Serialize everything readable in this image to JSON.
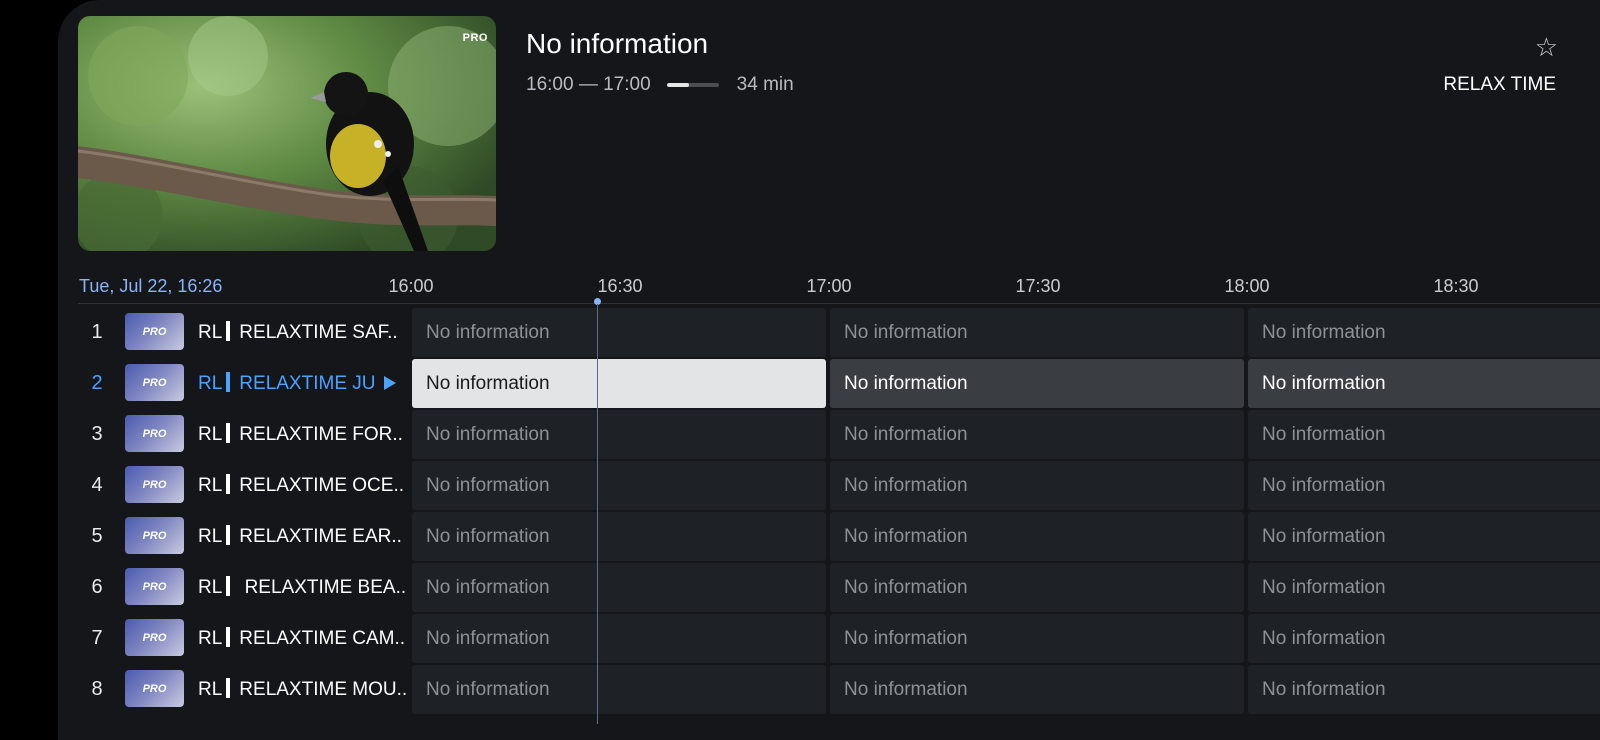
{
  "preview": {
    "badge": "PRO"
  },
  "program": {
    "title": "No information",
    "time_range": "16:00 — 17:00",
    "progress": 0.43,
    "duration": "34 min",
    "channel": "RELAX TIME",
    "icons": {
      "favorite": "star-outline-icon"
    }
  },
  "guide": {
    "date_label": "Tue, Jul 22, 16:26",
    "times": [
      "16:00",
      "16:30",
      "17:00",
      "17:30",
      "18:00",
      "18:30"
    ],
    "channels": [
      {
        "num": "1",
        "logo": "PRO",
        "prefix": "RL",
        "name": "RELAXTIME SAF..",
        "programs": [
          "No information",
          "No information",
          "No information"
        ]
      },
      {
        "num": "2",
        "logo": "PRO",
        "prefix": "RL",
        "name": "RELAXTIME JU",
        "programs": [
          "No information",
          "No information",
          "No information"
        ]
      },
      {
        "num": "3",
        "logo": "PRO",
        "prefix": "RL",
        "name": "RELAXTIME FOR..",
        "programs": [
          "No information",
          "No information",
          "No information"
        ]
      },
      {
        "num": "4",
        "logo": "PRO",
        "prefix": "RL",
        "name": "RELAXTIME OCE..",
        "programs": [
          "No information",
          "No information",
          "No information"
        ]
      },
      {
        "num": "5",
        "logo": "PRO",
        "prefix": "RL",
        "name": "RELAXTIME EAR..",
        "programs": [
          "No information",
          "No information",
          "No information"
        ]
      },
      {
        "num": "6",
        "logo": "PRO",
        "prefix": "RL",
        "name": " RELAXTIME BEA..",
        "programs": [
          "No information",
          "No information",
          "No information"
        ]
      },
      {
        "num": "7",
        "logo": "PRO",
        "prefix": "RL",
        "name": "RELAXTIME CAM..",
        "programs": [
          "No information",
          "No information",
          "No information"
        ]
      },
      {
        "num": "8",
        "logo": "PRO",
        "prefix": "RL",
        "name": "RELAXTIME MOU..",
        "programs": [
          "No information",
          "No information",
          "No information"
        ]
      }
    ]
  },
  "colors": {
    "accent": "#4aa3ff",
    "date": "#8ab4f8",
    "panel": "#141619"
  }
}
